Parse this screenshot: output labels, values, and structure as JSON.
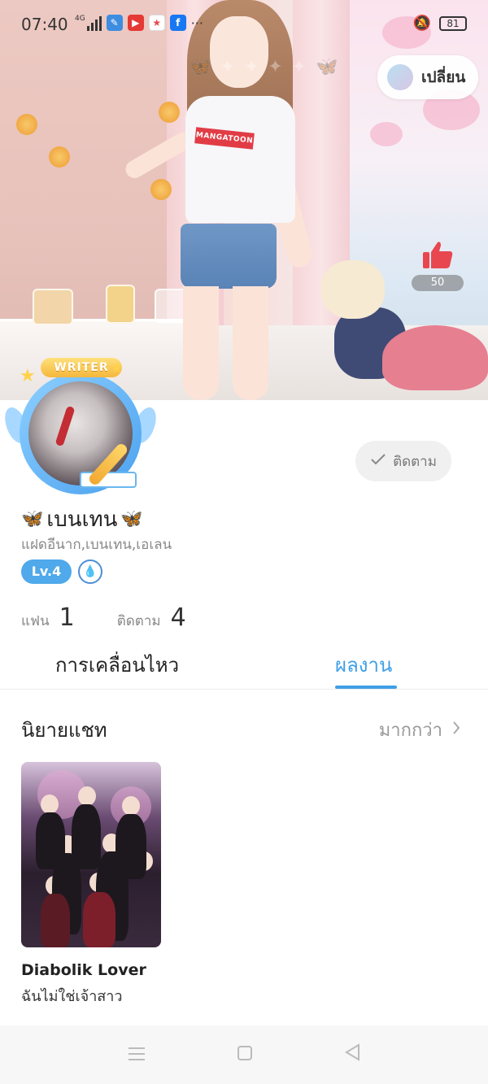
{
  "status_bar": {
    "time": "07:40",
    "network": "4G",
    "battery": "81"
  },
  "header": {
    "switch_label": "เปลี่ยน",
    "like_count": "50",
    "shirt_text": "MANGATOON"
  },
  "profile": {
    "badge": "WRITER",
    "follow_label": "ติดตาม",
    "name": "เบนเทน",
    "tagline": "แฝดอีนาก,เบนเทน,เอเลน",
    "level": "Lv.4",
    "stats": {
      "fans_label": "แฟน",
      "fans_value": "1",
      "following_label": "ติดตาม",
      "following_value": "4"
    }
  },
  "tabs": [
    {
      "label": "การเคลื่อนไหว"
    },
    {
      "label": "ผลงาน"
    }
  ],
  "section": {
    "title": "นิยายแชท",
    "more_label": "มากกว่า"
  },
  "works": [
    {
      "title": "Diabolik Lover",
      "subtitle": "ฉันไม่ใช่เจ้าสาว"
    }
  ],
  "colors": {
    "accent": "#3f9fe6",
    "like": "#e8474f",
    "level_badge": "#4fa9ea"
  }
}
